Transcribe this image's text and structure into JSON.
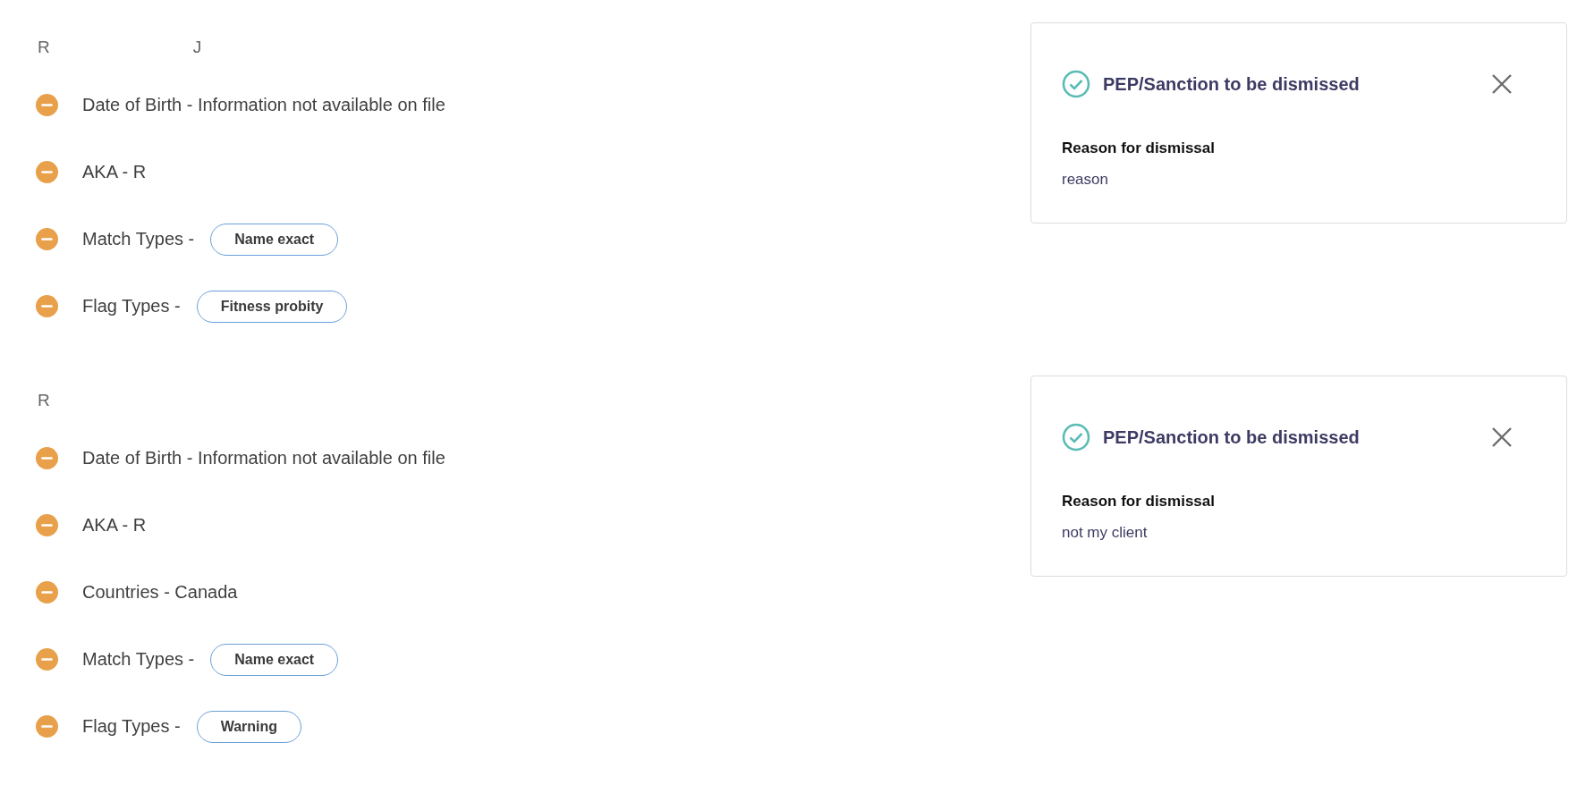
{
  "sections": [
    {
      "names": [
        "R",
        "J"
      ],
      "items": [
        {
          "kind": "text",
          "label": "Date of Birth - Information not available on file"
        },
        {
          "kind": "text",
          "label": "AKA - R"
        },
        {
          "kind": "tag",
          "label": "Match Types -",
          "tag": "Name exact"
        },
        {
          "kind": "tag",
          "label": "Flag Types -",
          "tag": "Fitness probity"
        }
      ],
      "card": {
        "title": "PEP/Sanction to be dismissed",
        "reason_label": "Reason for dismissal",
        "reason": "reason"
      }
    },
    {
      "names": [
        "R"
      ],
      "items": [
        {
          "kind": "text",
          "label": "Date of Birth - Information not available on file"
        },
        {
          "kind": "text",
          "label": "AKA - R"
        },
        {
          "kind": "text",
          "label": "Countries - Canada"
        },
        {
          "kind": "tag",
          "label": "Match Types -",
          "tag": "Name exact"
        },
        {
          "kind": "tag",
          "label": "Flag Types -",
          "tag": "Warning"
        }
      ],
      "card": {
        "title": "PEP/Sanction to be dismissed",
        "reason_label": "Reason for dismissal",
        "reason": "not my client"
      }
    }
  ]
}
